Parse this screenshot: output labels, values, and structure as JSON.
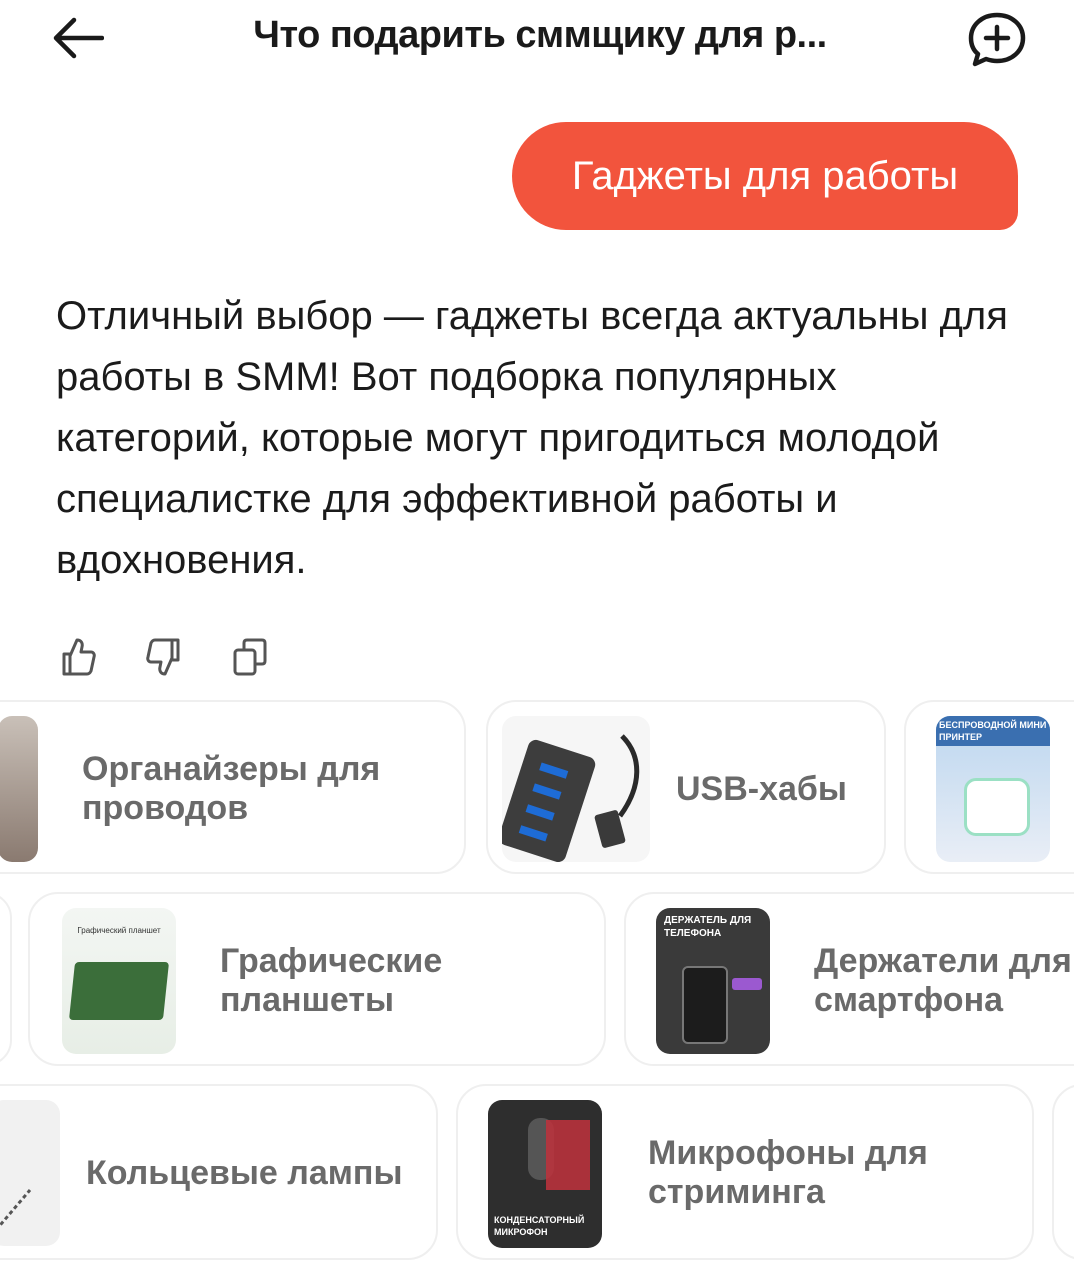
{
  "header": {
    "title": "Что подарить сммщику для р...",
    "back_icon": "arrow-left-icon",
    "new_chat_icon": "chat-plus-icon"
  },
  "user_message": {
    "text": "Гаджеты для работы",
    "color": "#f2543d"
  },
  "assistant_message": {
    "text": "Отличный выбор — гаджеты всегда актуальны для работы в SMM! Вот подборка популярных категорий, которые могут пригодиться молодой специалистке для эффективной работы и вдохновения."
  },
  "actions": [
    {
      "icon": "thumbs-up-icon"
    },
    {
      "icon": "thumbs-down-icon"
    },
    {
      "icon": "copy-icon"
    }
  ],
  "categories": {
    "row1": [
      {
        "label": "Органайзеры для проводов"
      },
      {
        "label": "USB-хабы"
      },
      {
        "label": "",
        "image_text": "БЕСПРОВОДНОЙ МИНИ ПРИНТЕР"
      }
    ],
    "row2": [
      {
        "label": "Графические планшеты",
        "image_text": "Графический планшет"
      },
      {
        "label": "Держатели для смартфона",
        "image_text": "ДЕРЖАТЕЛЬ ДЛЯ ТЕЛЕФОНА"
      }
    ],
    "row3": [
      {
        "label": "Кольцевые лампы"
      },
      {
        "label": "Микрофоны для стриминга",
        "image_text": "КОНДЕНСАТОРНЫЙ МИКРОФОН"
      }
    ]
  }
}
